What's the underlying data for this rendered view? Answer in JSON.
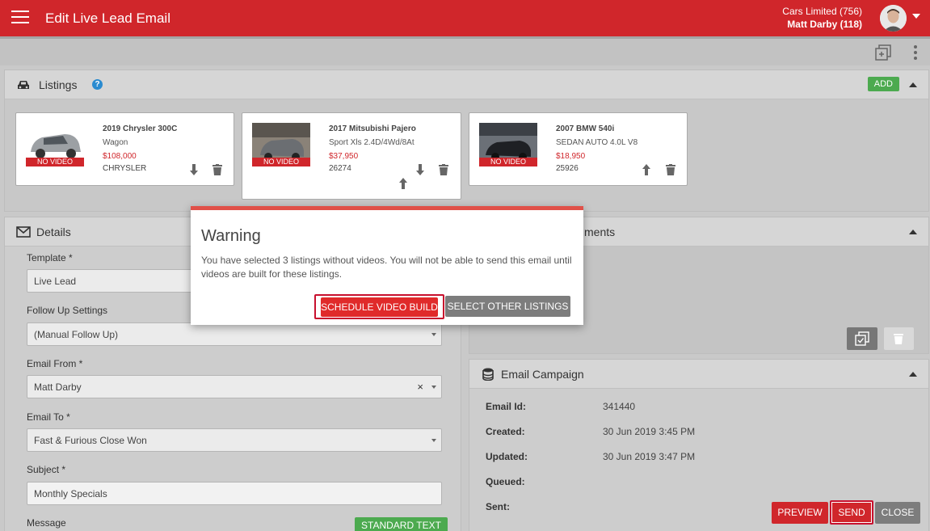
{
  "header": {
    "title": "Edit Live Lead Email",
    "account_line1": "Cars Limited (756)",
    "account_line2": "Matt Darby (118)"
  },
  "listings": {
    "title": "Listings",
    "help": "?",
    "add_label": "ADD",
    "cards": [
      {
        "title": "2019 Chrysler 300C",
        "sub": "Wagon",
        "price": "$108,000",
        "make": "CHRYSLER",
        "badge": "NO VIDEO"
      },
      {
        "title": "2017 Mitsubishi Pajero",
        "sub": "Sport Xls 2.4D/4Wd/8At",
        "price": "$37,950",
        "make": "26274",
        "badge": "NO VIDEO"
      },
      {
        "title": "2007 BMW 540i",
        "sub": "SEDAN AUTO 4.0L V8",
        "price": "$18,950",
        "make": "25926",
        "badge": "NO VIDEO"
      }
    ]
  },
  "details": {
    "title": "Details",
    "template_label": "Template *",
    "template_value": "Live Lead",
    "followup_label": "Follow Up Settings",
    "followup_value": "(Manual Follow Up)",
    "from_label": "Email From *",
    "from_value": "Matt Darby",
    "clear": "×",
    "to_label": "Email To *",
    "to_value": "Fast & Furious Close Won",
    "subject_label": "Subject *",
    "subject_value": "Monthly Specials",
    "message_label": "Message",
    "standard_text": "STANDARD TEXT"
  },
  "attachments": {
    "title_fragment": "ments"
  },
  "campaign": {
    "title": "Email Campaign",
    "email_id_label": "Email Id:",
    "email_id": "341440",
    "created_label": "Created:",
    "created": "30 Jun 2019 3:45 PM",
    "updated_label": "Updated:",
    "updated": "30 Jun 2019 3:47 PM",
    "queued_label": "Queued:",
    "sent_label": "Sent:"
  },
  "actions": {
    "preview": "PREVIEW",
    "send": "SEND",
    "close": "CLOSE"
  },
  "modal": {
    "title": "Warning",
    "body": "You have selected 3 listings without videos. You will not be able to send this email until videos are built for these listings.",
    "schedule": "SCHEDULE VIDEO BUILD",
    "select_other": "SELECT OTHER LISTINGS"
  },
  "colors": {
    "brand": "#d0262b",
    "green": "#4caa4f",
    "grey_button": "#7d7d7d"
  }
}
